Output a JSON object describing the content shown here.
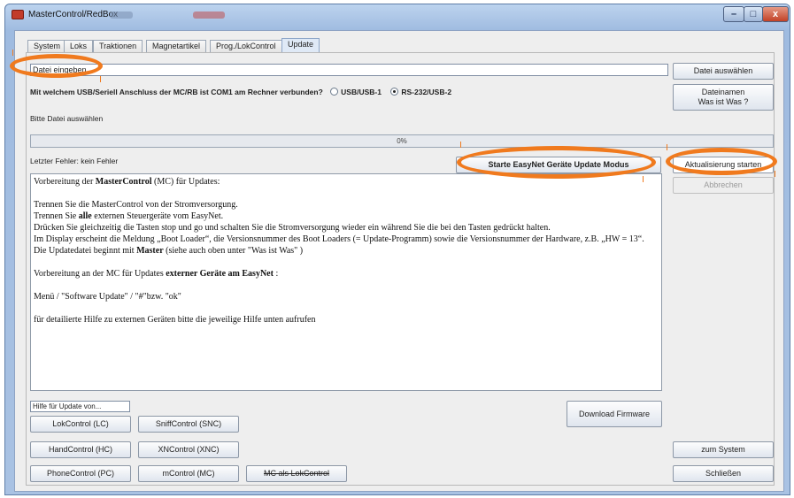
{
  "window": {
    "title": "MasterControl/RedBox",
    "controls": {
      "minimize": "–",
      "maximize": "□",
      "close": "x"
    }
  },
  "tabs": [
    "System",
    "Loks",
    "Traktionen",
    "Magnetartikel",
    "Prog./LokControl",
    "Update"
  ],
  "active_tab": "Update",
  "file": {
    "input_value": "Datei eingeben...",
    "select_button": "Datei auswählen",
    "names_button_line1": "Dateinamen",
    "names_button_line2": "Was ist Was ?"
  },
  "connection": {
    "question": "Mit welchem USB/Seriell Anschluss der MC/RB ist COM1 am Rechner verbunden?",
    "option_usb": "USB/USB-1",
    "option_rs232": "RS-232/USB-2",
    "selected": "RS-232/USB-2"
  },
  "status": {
    "select_file_text": "Bitte Datei auswählen",
    "progress_label": "0%",
    "progress_fraction": 0,
    "last_error_label": "Letzter Fehler:",
    "last_error_value": "kein Fehler"
  },
  "actions": {
    "easynet_button": "Starte EasyNet Geräte Update Modus",
    "update_button": "Aktualisierung starten",
    "cancel_button": "Abbrechen"
  },
  "instructions": {
    "p1_pre": "Vorbereitung der ",
    "p1_bold": "MasterControl",
    "p1_post": " (MC) für Updates:",
    "p2": "Trennen Sie die MasterControl von der Stromversorgung.",
    "p3_pre": "Trennen Sie ",
    "p3_bold": "alle",
    "p3_post": " externen Steuergeräte vom EasyNet.",
    "p4": "Drücken Sie gleichzeitig die Tasten stop und go und schalten Sie die Stromversorgung wieder ein während Sie die bei den Tasten gedrückt halten.",
    "p5": "Im Display erscheint die Meldung „Boot Loader“, die Versionsnummer des Boot Loaders (= Update-Programm) sowie die Versionsnummer der Hardware, z.B. „HW = 13“.",
    "p6_pre": "Die Updatedatei beginnt mit ",
    "p6_bold": "Master",
    "p6_post": " (siehe auch oben unter \"Was ist Was\" )",
    "p7_pre": "Vorbereitung an der MC für Updates ",
    "p7_bold": "externer Geräte am EasyNet",
    "p7_post": " :",
    "p8": "Menü / \"Software Update\" / \"#\"bzw. \"ok\"",
    "p9": "für detailierte Hilfe zu externen Geräten bitte die jeweilige Hilfe unten aufrufen"
  },
  "help": {
    "label": "Hilfe für Update von...",
    "lokcontrol": "LokControl (LC)",
    "sniffcontrol": "SniffControl (SNC)",
    "handcontrol": "HandControl (HC)",
    "xncontrol": "XNControl (XNC)",
    "phonecontrol": "PhoneControl (PC)",
    "mcontrol": "mControl (MC)",
    "mc_as_lokcontrol": "MC als LokControl"
  },
  "download_firmware": "Download Firmware",
  "to_system": "zum System",
  "close": "Schließen",
  "colors": {
    "highlight": "#f07a1e",
    "window_frame": "#a9c2e3",
    "panel": "#eeeeee"
  }
}
